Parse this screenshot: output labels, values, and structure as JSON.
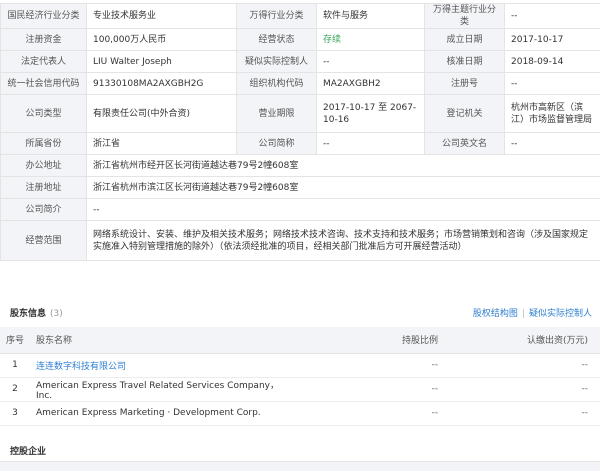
{
  "info": {
    "rows": [
      [
        {
          "k": "国民经济行业分类"
        },
        {
          "v": "专业技术服务业"
        },
        {
          "k": "万得行业分类"
        },
        {
          "v": "软件与服务"
        },
        {
          "k": "万得主题行业分类"
        },
        {
          "v": "--"
        }
      ],
      [
        {
          "k": "注册资金"
        },
        {
          "v": "100,000万人民币"
        },
        {
          "k": "经营状态"
        },
        {
          "v": "存续",
          "green": true
        },
        {
          "k": "成立日期"
        },
        {
          "v": "2017-10-17"
        }
      ],
      [
        {
          "k": "法定代表人"
        },
        {
          "v": "LIU Walter Joseph"
        },
        {
          "k": "疑似实际控制人"
        },
        {
          "v": "--"
        },
        {
          "k": "核准日期"
        },
        {
          "v": "2018-09-14"
        }
      ],
      [
        {
          "k": "统一社会信用代码"
        },
        {
          "v": "91330108MA2AXGBH2G"
        },
        {
          "k": "组织机构代码"
        },
        {
          "v": "MA2AXGBH2"
        },
        {
          "k": "注册号"
        },
        {
          "v": "--"
        }
      ],
      [
        {
          "k": "公司类型"
        },
        {
          "v": "有限责任公司(中外合资)"
        },
        {
          "k": "营业期限"
        },
        {
          "v": "2017-10-17 至 2067-10-16"
        },
        {
          "k": "登记机关"
        },
        {
          "v": "杭州市高新区（滨江）市场监督管理局"
        }
      ],
      [
        {
          "k": "所属省份"
        },
        {
          "v": "浙江省"
        },
        {
          "k": "公司简称"
        },
        {
          "v": "--"
        },
        {
          "k": "公司英文名"
        },
        {
          "v": "--"
        }
      ]
    ],
    "office_address_label": "办公地址",
    "office_address": "浙江省杭州市经开区长河街道越达巷79号2幢608室",
    "reg_address_label": "注册地址",
    "reg_address": "浙江省杭州市滨江区长河街道越达巷79号2幢608室",
    "intro_label": "公司简介",
    "intro": "--",
    "scope_label": "经营范围",
    "scope": "网络系统设计、安装、维护及相关技术服务；网络技术技术咨询、技术支持和技术服务；市场营销策划和咨询（涉及国家规定实施准入特别管理措施的除外）（依法须经批准的项目，经相关部门批准后方可开展经营活动）"
  },
  "shareholders": {
    "title": "股东信息",
    "count": "(3)",
    "link_equity": "股权结构图",
    "link_controller": "疑似实际控制人",
    "headers": {
      "no": "序号",
      "name": "股东名称",
      "ratio": "持股比例",
      "amount": "认缴出资(万元)"
    },
    "rows": [
      {
        "no": "1",
        "name": "连连数字科技有限公司",
        "ratio": "--",
        "amount": "--",
        "link": true
      },
      {
        "no": "2",
        "name": "American Express Travel Related Services Company，Inc.",
        "ratio": "--",
        "amount": "--",
        "link": false
      },
      {
        "no": "3",
        "name": "American Express Marketing · Development Corp.",
        "ratio": "--",
        "amount": "--",
        "link": false
      }
    ]
  },
  "holding": {
    "title": "控股企业"
  }
}
